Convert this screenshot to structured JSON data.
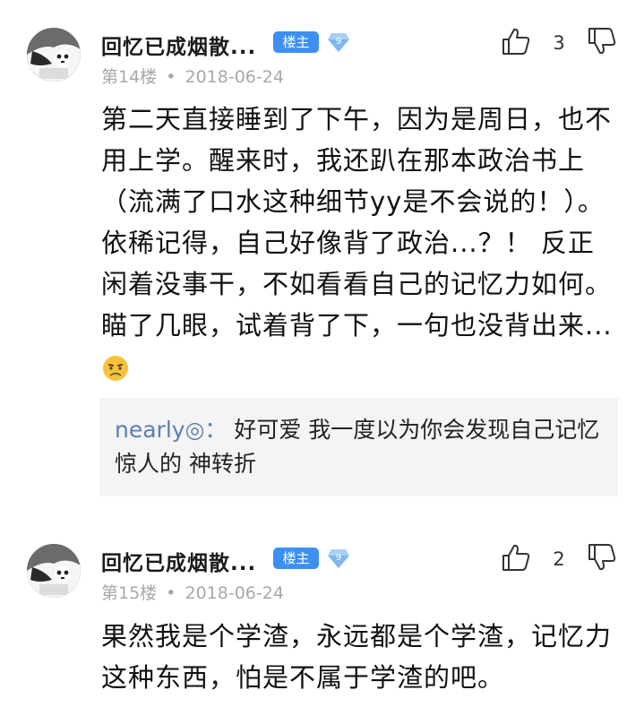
{
  "posts": [
    {
      "username": "回忆已成烟散...",
      "badge": "楼主",
      "level": "9",
      "floor": "第14楼",
      "separator": "•",
      "date": "2018-06-24",
      "likes": "3",
      "body": "第二天直接睡到了下午，因为是周日，也不用上学。醒来时，我还趴在那本政治书上（流满了口水这种细节yy是不会说的！）。依稀记得，自己好像背了政治...？！ 反正闲着没事干，不如看看自己的记忆力如何。瞄了几眼，试着背了下，一句也没背出来...",
      "emoji": "sick-face-emoji",
      "reply": {
        "author": "nearly◎：",
        "text": " 好可爱 我一度以为你会发现自己记忆惊人的 神转折"
      }
    },
    {
      "username": "回忆已成烟散...",
      "badge": "楼主",
      "level": "9",
      "floor": "第15楼",
      "separator": "•",
      "date": "2018-06-24",
      "likes": "2",
      "body": "果然我是个学渣，永远都是个学渣，记忆力这种东西，怕是不属于学渣的吧。"
    }
  ],
  "icons": {
    "like": "thumbs-up-icon",
    "dislike": "thumbs-down-icon",
    "level": "diamond-level-icon",
    "accent": "#3d8ff2",
    "reply_bg": "#f4f4f4",
    "reply_author_color": "#5a7eb4"
  }
}
